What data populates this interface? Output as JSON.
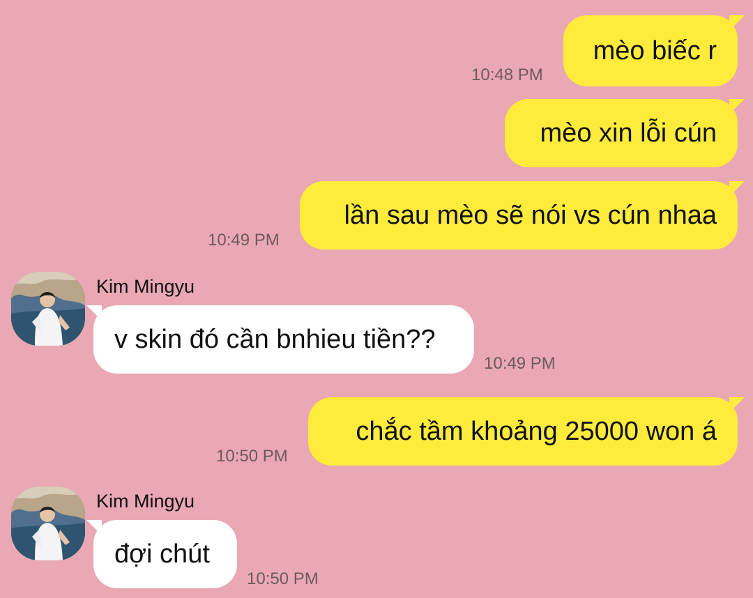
{
  "theme": {
    "background": "#E9A8B3",
    "outgoing_bubble": "#FFEB3B",
    "incoming_bubble": "#FFFFFF"
  },
  "messages": [
    {
      "direction": "outgoing",
      "text": "mèo biếc r",
      "time": "10:48 PM"
    },
    {
      "direction": "outgoing",
      "text": "mèo xin lỗi cún",
      "time": ""
    },
    {
      "direction": "outgoing",
      "text": "lần sau mèo sẽ nói vs cún nhaa",
      "time": "10:49 PM"
    },
    {
      "direction": "incoming",
      "sender": "Kim Mingyu",
      "avatar_icon": "profile-photo-icon",
      "text": "v skin đó cần bnhieu tiền??",
      "time": "10:49 PM"
    },
    {
      "direction": "outgoing",
      "text": "chắc tầm khoảng 25000 won á",
      "time": "10:50 PM"
    },
    {
      "direction": "incoming",
      "sender": "Kim Mingyu",
      "avatar_icon": "profile-photo-icon",
      "text": "đợi chút",
      "time": "10:50 PM"
    }
  ]
}
